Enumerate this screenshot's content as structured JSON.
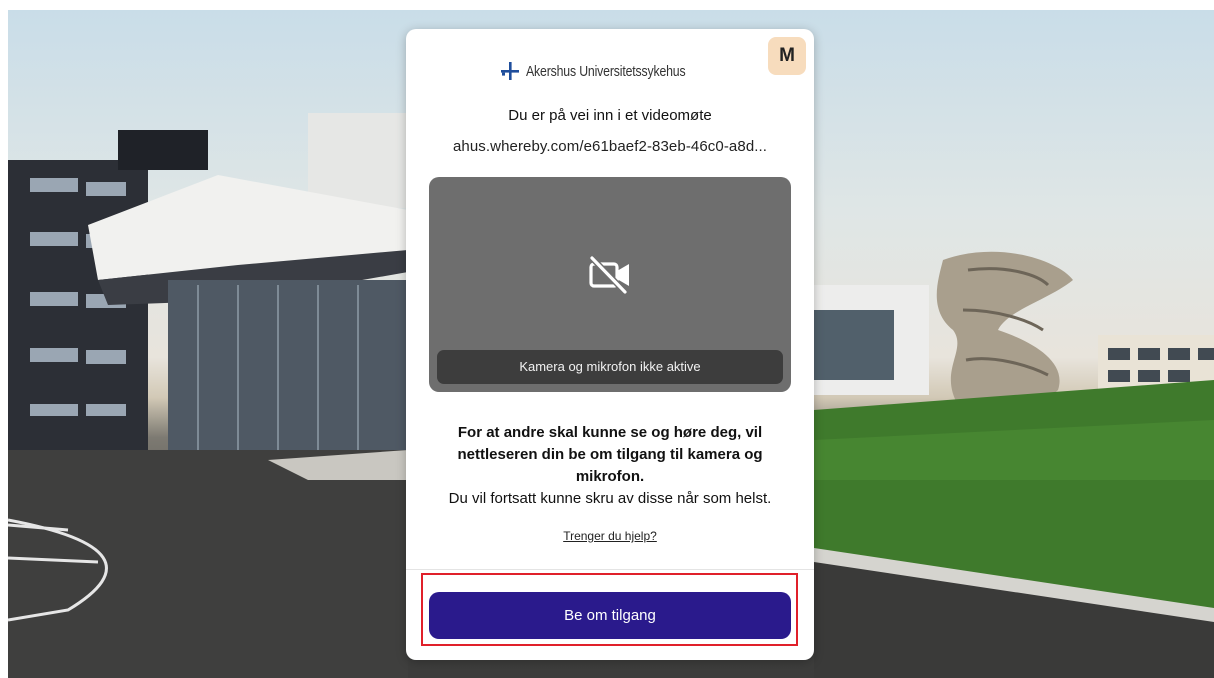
{
  "header": {
    "brand_name": "Akershus Universitetssykehus",
    "avatar_initial": "M"
  },
  "meeting": {
    "heading": "Du er på vei inn i et videomøte",
    "url": "ahus.whereby.com/e61baef2-83eb-46c0-a8d..."
  },
  "preview": {
    "icon": "camera-off-icon",
    "status": "Kamera og mikrofon ikke aktive"
  },
  "info": {
    "line1": "For at andre skal kunne se og høre deg, vil",
    "line2": "nettleseren din be om tilgang til kamera og",
    "line3": "mikrofon.",
    "line4": "Du vil fortsatt kunne skru av disse når som helst."
  },
  "help": {
    "link": "Trenger du hjelp?"
  },
  "actions": {
    "request_access": "Be om tilgang"
  },
  "colors": {
    "primary_button": "#2a1a8c",
    "avatar_bg": "#f7dcbd",
    "highlight": "#e0202a",
    "brand_blue": "#1f4e9c"
  }
}
